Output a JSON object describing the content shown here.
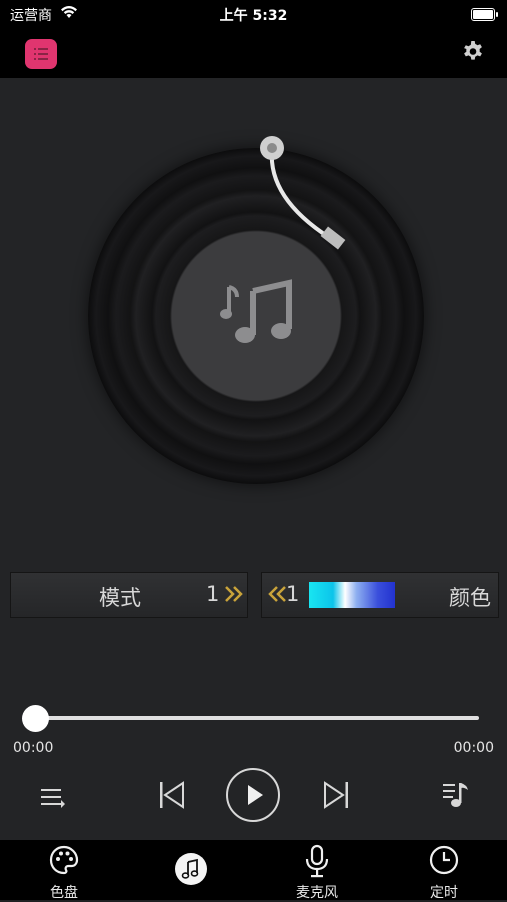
{
  "status_bar": {
    "carrier": "运营商",
    "time": "上午 5:32"
  },
  "topbar": {
    "menu_icon": "list-icon",
    "settings_icon": "gear-icon",
    "accent": "#e0356f"
  },
  "player": {
    "mode_label": "模式",
    "mode_value": "1",
    "color_value": "1",
    "color_label": "颜色",
    "time_current": "00:00",
    "time_total": "00:00",
    "progress": 0
  },
  "tabs": [
    {
      "label": "色盘",
      "icon": "palette-icon"
    },
    {
      "label": "",
      "icon": "music-note-icon",
      "active": true
    },
    {
      "label": "麦克风",
      "icon": "microphone-icon"
    },
    {
      "label": "定时",
      "icon": "clock-icon"
    }
  ],
  "colors": {
    "gold_arrows": "#c9a33a",
    "background": "#232426"
  }
}
